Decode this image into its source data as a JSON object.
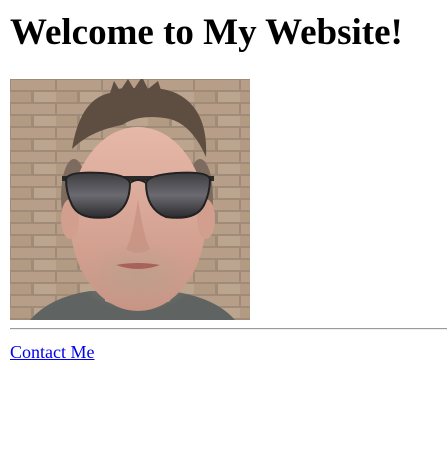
{
  "page": {
    "heading": "Welcome to My Website!",
    "photo": {
      "alt": "Portrait of a man wearing sunglasses in front of a brick wall",
      "subject": "man-with-sunglasses",
      "background": "brick-wall"
    },
    "contact_link": "Contact Me"
  },
  "colors": {
    "background": "#ffffff",
    "text": "#000000",
    "link": "#0000ee",
    "divider": "#9a9a9a"
  }
}
